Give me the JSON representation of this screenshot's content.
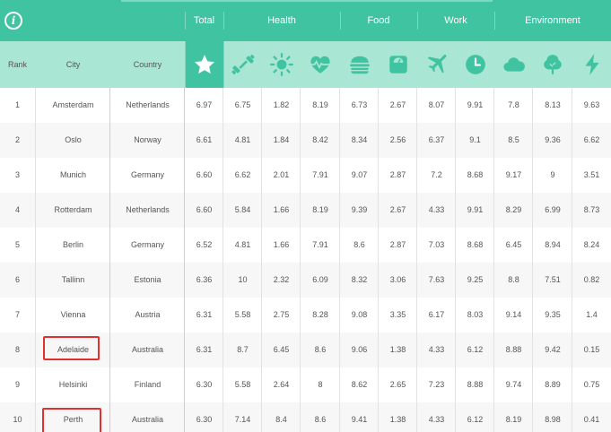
{
  "groups": [
    "Total",
    "Health",
    "Food",
    "Work",
    "Environment"
  ],
  "header": {
    "rank": "Rank",
    "city": "City",
    "country": "Country"
  },
  "icons": [
    "star-icon",
    "dumbbell-icon",
    "sun-icon",
    "heartbeat-icon",
    "burger-icon",
    "scale-icon",
    "plane-icon",
    "clock-icon",
    "cloud-icon",
    "tree-icon",
    "lightning-icon"
  ],
  "colors": {
    "accent": "#3fc3a0",
    "header_light": "#a9e6d3",
    "highlight": "#e03131"
  },
  "highlighted_cities": [
    "Adelaide",
    "Perth"
  ],
  "rows": [
    {
      "rank": "1",
      "city": "Amsterdam",
      "country": "Netherlands",
      "total": "6.97",
      "v": [
        "6.75",
        "1.82",
        "8.19",
        "6.73",
        "2.67",
        "8.07",
        "9.91",
        "7.8",
        "8.13",
        "9.63"
      ]
    },
    {
      "rank": "2",
      "city": "Oslo",
      "country": "Norway",
      "total": "6.61",
      "v": [
        "4.81",
        "1.84",
        "8.42",
        "8.34",
        "2.56",
        "6.37",
        "9.1",
        "8.5",
        "9.36",
        "6.62"
      ]
    },
    {
      "rank": "3",
      "city": "Munich",
      "country": "Germany",
      "total": "6.60",
      "v": [
        "6.62",
        "2.01",
        "7.91",
        "9.07",
        "2.87",
        "7.2",
        "8.68",
        "9.17",
        "9",
        "3.51"
      ]
    },
    {
      "rank": "4",
      "city": "Rotterdam",
      "country": "Netherlands",
      "total": "6.60",
      "v": [
        "5.84",
        "1.66",
        "8.19",
        "9.39",
        "2.67",
        "4.33",
        "9.91",
        "8.29",
        "6.99",
        "8.73"
      ]
    },
    {
      "rank": "5",
      "city": "Berlin",
      "country": "Germany",
      "total": "6.52",
      "v": [
        "4.81",
        "1.66",
        "7.91",
        "8.6",
        "2.87",
        "7.03",
        "8.68",
        "6.45",
        "8.94",
        "8.24"
      ]
    },
    {
      "rank": "6",
      "city": "Tallinn",
      "country": "Estonia",
      "total": "6.36",
      "v": [
        "10",
        "2.32",
        "6.09",
        "8.32",
        "3.06",
        "7.63",
        "9.25",
        "8.8",
        "7.51",
        "0.82"
      ]
    },
    {
      "rank": "7",
      "city": "Vienna",
      "country": "Austria",
      "total": "6.31",
      "v": [
        "5.58",
        "2.75",
        "8.28",
        "9.08",
        "3.35",
        "6.17",
        "8.03",
        "9.14",
        "9.35",
        "1.4"
      ]
    },
    {
      "rank": "8",
      "city": "Adelaide",
      "country": "Australia",
      "total": "6.31",
      "v": [
        "8.7",
        "6.45",
        "8.6",
        "9.06",
        "1.38",
        "4.33",
        "6.12",
        "8.88",
        "9.42",
        "0.15"
      ]
    },
    {
      "rank": "9",
      "city": "Helsinki",
      "country": "Finland",
      "total": "6.30",
      "v": [
        "5.58",
        "2.64",
        "8",
        "8.62",
        "2.65",
        "7.23",
        "8.88",
        "9.74",
        "8.89",
        "0.75"
      ]
    },
    {
      "rank": "10",
      "city": "Perth",
      "country": "Australia",
      "total": "6.30",
      "v": [
        "7.14",
        "8.4",
        "8.6",
        "9.41",
        "1.38",
        "4.33",
        "6.12",
        "8.19",
        "8.98",
        "0.41"
      ]
    }
  ]
}
